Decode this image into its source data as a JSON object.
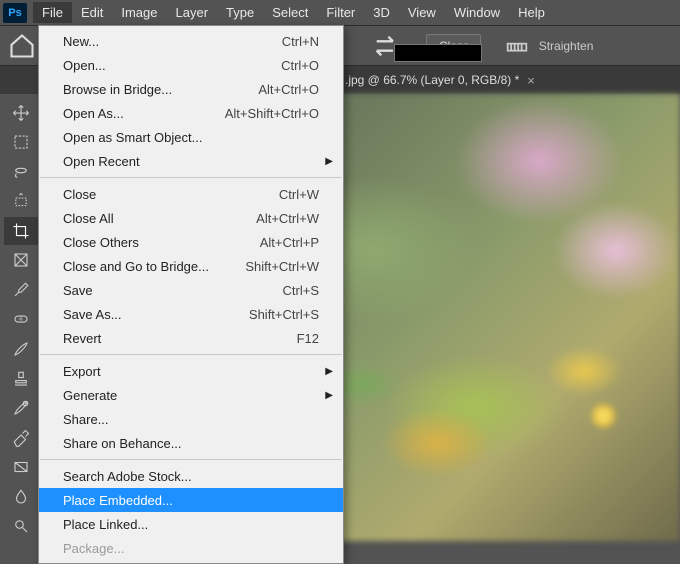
{
  "app": {
    "logo": "Ps"
  },
  "menubar": [
    "File",
    "Edit",
    "Image",
    "Layer",
    "Type",
    "Select",
    "Filter",
    "3D",
    "View",
    "Window",
    "Help"
  ],
  "active_menu": "File",
  "optionbar": {
    "clear": "Clear",
    "straighten": "Straighten"
  },
  "document_tab": {
    "title": ".jpg @ 66.7% (Layer 0, RGB/8) *",
    "close": "×"
  },
  "file_menu": {
    "highlighted": "Place Embedded...",
    "groups": [
      [
        {
          "label": "New...",
          "shortcut": "Ctrl+N"
        },
        {
          "label": "Open...",
          "shortcut": "Ctrl+O"
        },
        {
          "label": "Browse in Bridge...",
          "shortcut": "Alt+Ctrl+O"
        },
        {
          "label": "Open As...",
          "shortcut": "Alt+Shift+Ctrl+O"
        },
        {
          "label": "Open as Smart Object..."
        },
        {
          "label": "Open Recent",
          "submenu": true
        }
      ],
      [
        {
          "label": "Close",
          "shortcut": "Ctrl+W"
        },
        {
          "label": "Close All",
          "shortcut": "Alt+Ctrl+W"
        },
        {
          "label": "Close Others",
          "shortcut": "Alt+Ctrl+P"
        },
        {
          "label": "Close and Go to Bridge...",
          "shortcut": "Shift+Ctrl+W"
        },
        {
          "label": "Save",
          "shortcut": "Ctrl+S"
        },
        {
          "label": "Save As...",
          "shortcut": "Shift+Ctrl+S"
        },
        {
          "label": "Revert",
          "shortcut": "F12"
        }
      ],
      [
        {
          "label": "Export",
          "submenu": true
        },
        {
          "label": "Generate",
          "submenu": true
        },
        {
          "label": "Share..."
        },
        {
          "label": "Share on Behance..."
        }
      ],
      [
        {
          "label": "Search Adobe Stock..."
        },
        {
          "label": "Place Embedded..."
        },
        {
          "label": "Place Linked..."
        },
        {
          "label": "Package...",
          "disabled": true
        }
      ]
    ]
  },
  "tools": [
    {
      "name": "move-tool",
      "active": false
    },
    {
      "name": "marquee-tool",
      "active": false
    },
    {
      "name": "lasso-tool",
      "active": false
    },
    {
      "name": "quick-select-tool",
      "active": false
    },
    {
      "name": "crop-tool",
      "active": true
    },
    {
      "name": "frame-tool",
      "active": false
    },
    {
      "name": "eyedropper-tool",
      "active": false
    },
    {
      "name": "healing-tool",
      "active": false
    },
    {
      "name": "brush-tool",
      "active": false
    },
    {
      "name": "stamp-tool",
      "active": false
    },
    {
      "name": "history-brush-tool",
      "active": false
    },
    {
      "name": "eraser-tool",
      "active": false
    },
    {
      "name": "gradient-tool",
      "active": false
    },
    {
      "name": "blur-tool",
      "active": false
    },
    {
      "name": "dodge-tool",
      "active": false
    }
  ]
}
